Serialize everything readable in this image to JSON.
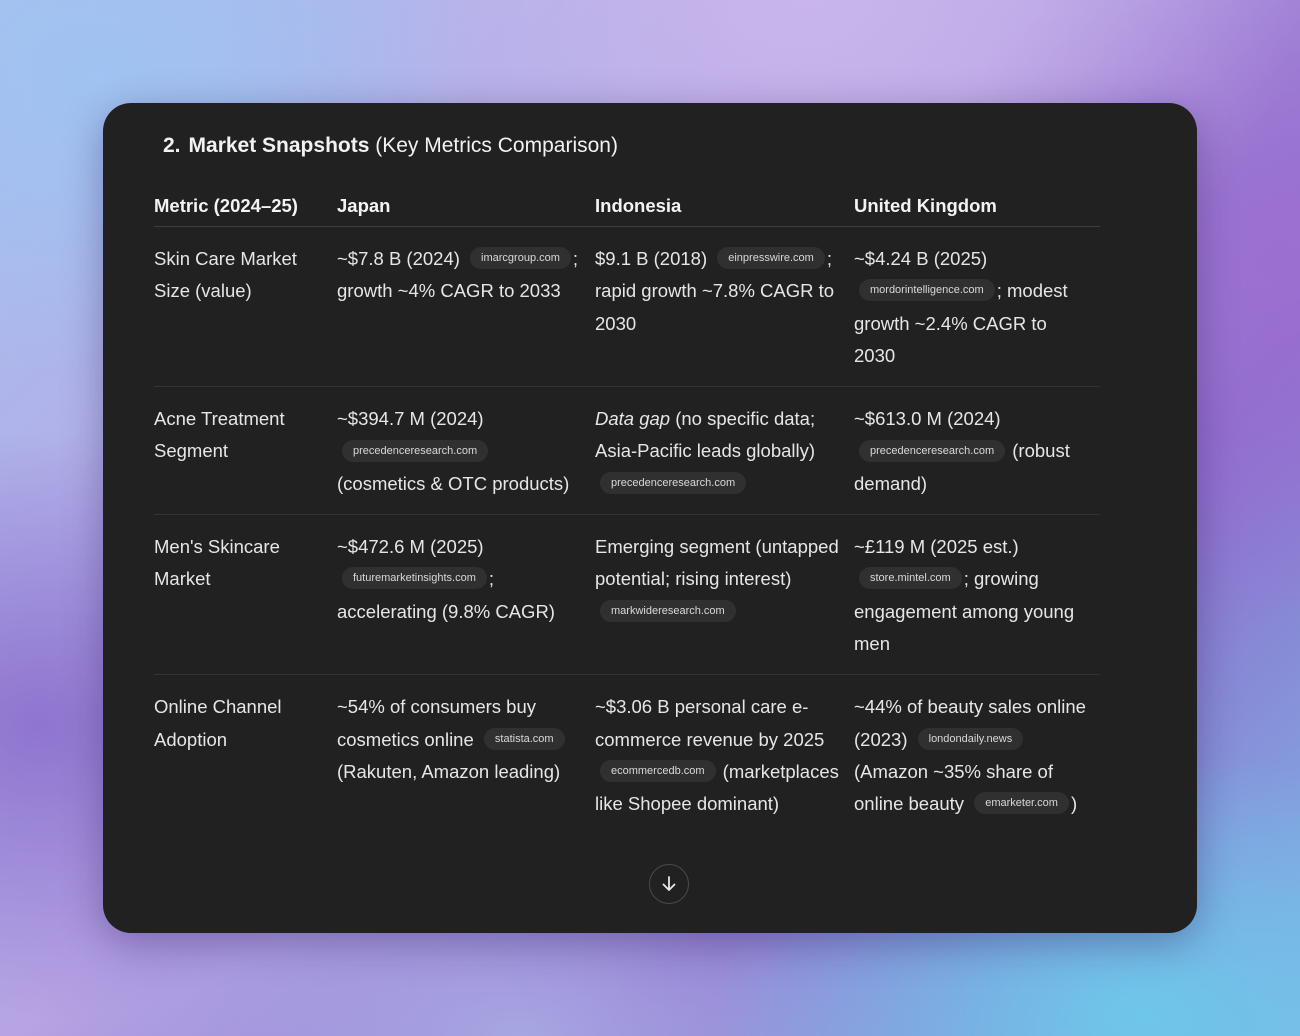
{
  "section": {
    "number": "2.",
    "title_bold": "Market Snapshots",
    "title_rest": " (Key Metrics Comparison)"
  },
  "table": {
    "headers": [
      "Metric (2024–25)",
      "Japan",
      "Indonesia",
      "United Kingdom"
    ],
    "rows": [
      {
        "metric": "Skin Care Market Size (value)",
        "japan": {
          "pre": "~$7.8 B (2024) ",
          "chip": "imarcgroup.com",
          "post": "; growth ~4% CAGR to 2033"
        },
        "indonesia": {
          "pre": "$9.1 B (2018) ",
          "chip": "einpresswire.com",
          "post": "; rapid growth ~7.8% CAGR to 2030"
        },
        "uk": {
          "pre": "~$4.24 B (2025) ",
          "chip": "mordorintelligence.com",
          "post": "; modest growth ~2.4% CAGR to 2030"
        }
      },
      {
        "metric": "Acne Treatment Segment",
        "japan": {
          "pre": "~$394.7 M (2024) ",
          "chip": "precedenceresearch.com",
          "post": " (cosmetics & OTC products)"
        },
        "indonesia": {
          "italic": "Data gap",
          "pre": " (no specific data; Asia-Pacific leads globally) ",
          "chip": "precedenceresearch.com",
          "post": ""
        },
        "uk": {
          "pre": "~$613.0 M (2024) ",
          "chip": "precedenceresearch.com",
          "post": " (robust demand)"
        }
      },
      {
        "metric": "Men's Skincare Market",
        "japan": {
          "pre": "~$472.6 M (2025) ",
          "chip": "futuremarketinsights.com",
          "post": "; accelerating (9.8% CAGR)"
        },
        "indonesia": {
          "pre": "Emerging segment (untapped potential; rising interest) ",
          "chip": "markwideresearch.com",
          "post": ""
        },
        "uk": {
          "pre": "~£119 M (2025 est.) ",
          "chip": "store.mintel.com",
          "post": "; growing engagement among young men"
        }
      },
      {
        "metric": "Online Channel Adoption",
        "japan": {
          "pre": "~54% of consumers buy cosmetics online ",
          "chip": "statista.com",
          "post": " (Rakuten, Amazon leading)"
        },
        "indonesia": {
          "pre": "~$3.06 B personal care e-commerce revenue by 2025 ",
          "chip": "ecommercedb.com",
          "post": " (marketplaces like Shopee dominant)"
        },
        "uk": {
          "pre": "~44% of beauty sales online (2023) ",
          "chip": "londondaily.news",
          "post": " (Amazon ~35% share of online beauty ",
          "chip2": "emarketer.com",
          "post2": ")"
        }
      }
    ]
  },
  "scroll_button": {
    "icon": "arrow-down-icon"
  }
}
